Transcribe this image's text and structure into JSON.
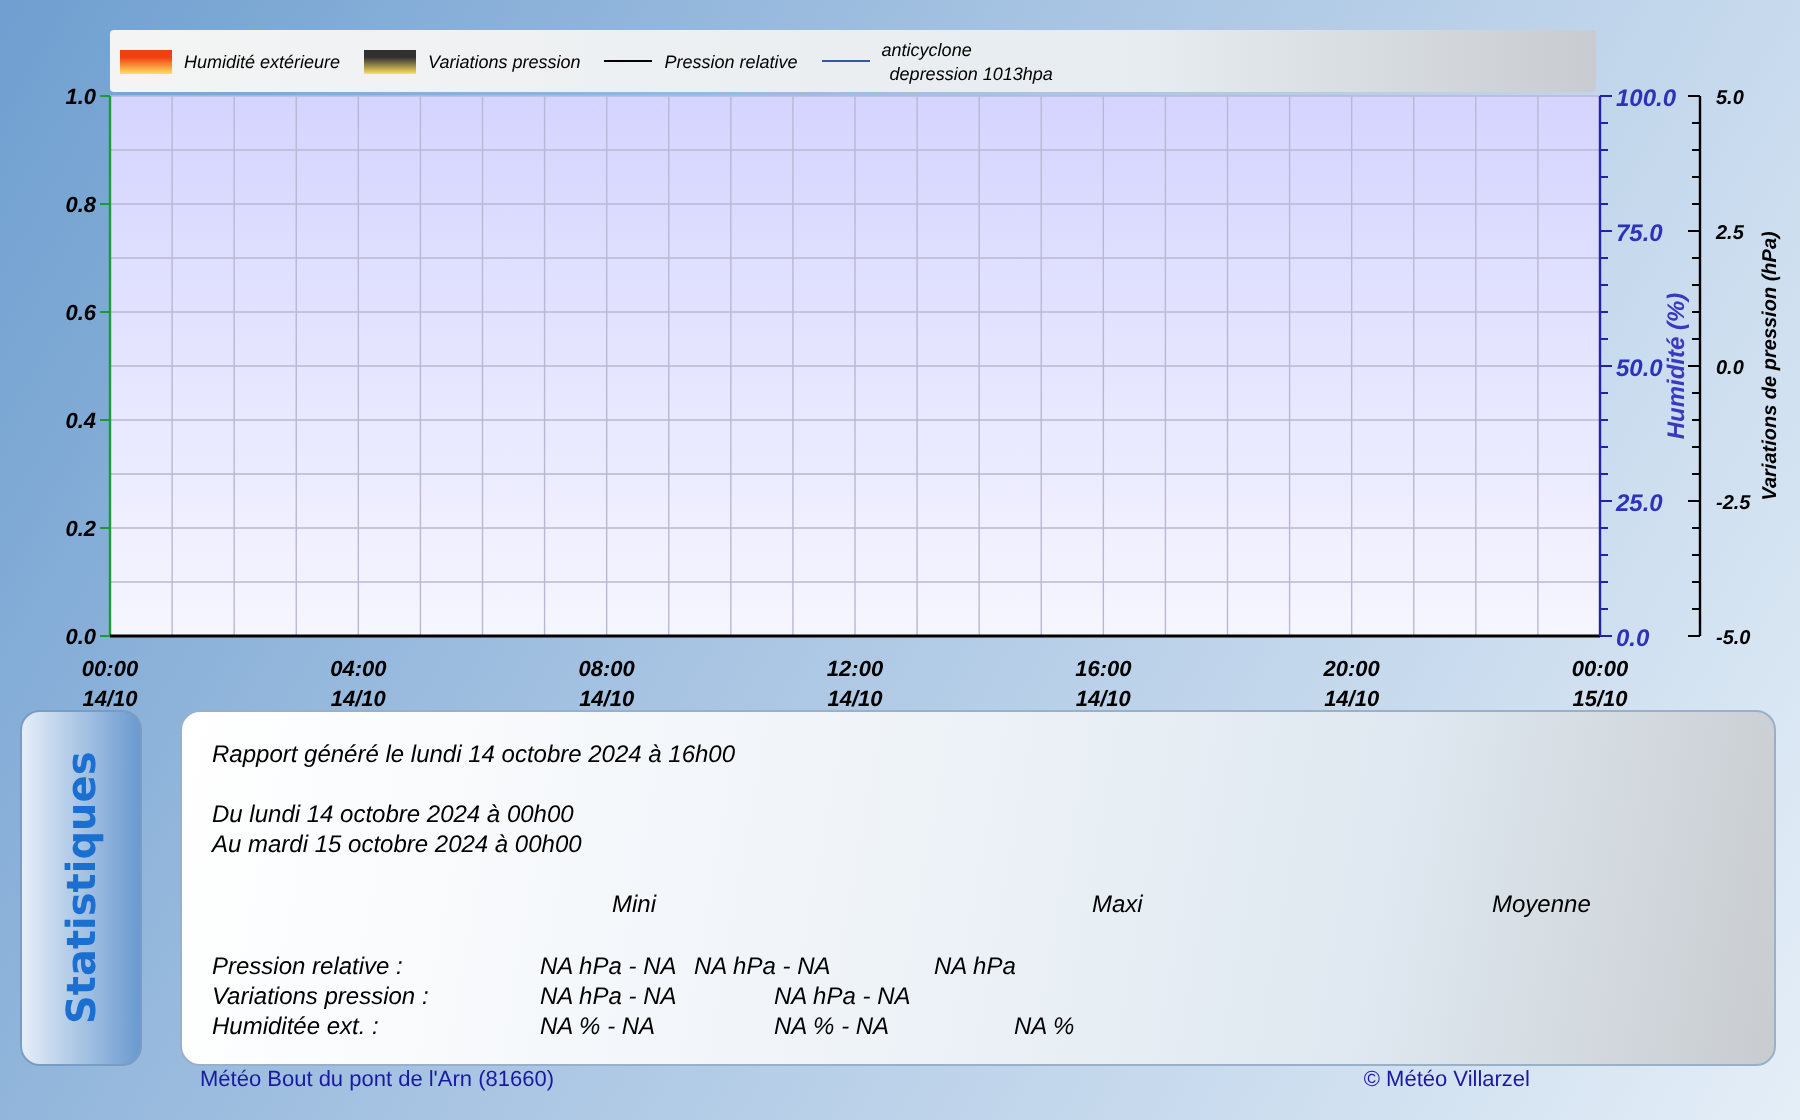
{
  "legend": [
    {
      "kind": "swatch",
      "label": "Humidité extérieure",
      "color": "#f04010"
    },
    {
      "kind": "swatch",
      "label": "Variations pression",
      "color": "#303030"
    },
    {
      "kind": "line",
      "label": "Pression relative",
      "color": "#000000"
    },
    {
      "kind": "line",
      "label": "anticyclone",
      "label_2": "depression 1013hpa",
      "color": "#3355aa"
    }
  ],
  "chart": {
    "left_axis": {
      "ticks": [
        "1.0",
        "0.8",
        "0.6",
        "0.4",
        "0.2",
        "0.0"
      ]
    },
    "humidity_axis": {
      "label": "Humidité (%)",
      "ticks": [
        "100.0",
        "75.0",
        "50.0",
        "25.0",
        "0.0"
      ]
    },
    "pressure_axis": {
      "label": "Variations de pression (hPa)",
      "ticks": [
        "5.0",
        "2.5",
        "0.0",
        "-2.5",
        "-5.0"
      ]
    },
    "x_ticks": [
      {
        "time": "00:00",
        "date": "14/10"
      },
      {
        "time": "04:00",
        "date": "14/10"
      },
      {
        "time": "08:00",
        "date": "14/10"
      },
      {
        "time": "12:00",
        "date": "14/10"
      },
      {
        "time": "16:00",
        "date": "14/10"
      },
      {
        "time": "20:00",
        "date": "14/10"
      },
      {
        "time": "00:00",
        "date": "15/10"
      }
    ]
  },
  "stats": {
    "tab_label": "Statistiques",
    "report": "Rapport généré le lundi 14 octobre 2024 à 16h00",
    "period": [
      "Du lundi 14 octobre 2024 à 00h00",
      "Au mardi 15 octobre 2024 à 00h00"
    ],
    "headers": [
      "Mini",
      "Maxi",
      "Moyenne"
    ],
    "rows": [
      {
        "label": "Pression relative :",
        "values": [
          "NA hPa - NA",
          "NA hPa - NA",
          "NA hPa"
        ]
      },
      {
        "label": "Variations pression :",
        "values": [
          "NA hPa - NA",
          "NA hPa - NA"
        ]
      },
      {
        "label": "Humiditée ext. :",
        "values": [
          "NA % - NA",
          "NA % - NA",
          "NA %"
        ]
      }
    ]
  },
  "footer": {
    "station": "Météo Bout du pont de l'Arn (81660)",
    "copyright": "© Météo Villarzel"
  }
}
